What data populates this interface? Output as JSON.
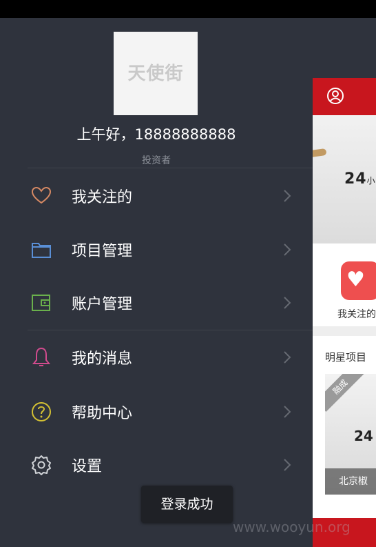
{
  "drawer": {
    "logo_text": "天使街",
    "greeting": "上午好，18888888888",
    "role": "投资者",
    "menu": [
      {
        "label": "我关注的",
        "icon": "heart-icon"
      },
      {
        "label": "项目管理",
        "icon": "folder-icon"
      },
      {
        "label": "账户管理",
        "icon": "wallet-icon"
      },
      {
        "label": "我的消息",
        "icon": "bell-icon"
      },
      {
        "label": "帮助中心",
        "icon": "help-icon"
      },
      {
        "label": "设置",
        "icon": "gear-icon"
      }
    ]
  },
  "main": {
    "banner_number": "24",
    "banner_unit": "小",
    "quick_label": "我关注的",
    "star_title": "明星项目",
    "star_card": {
      "ribbon": "融成",
      "number": "24",
      "caption": "北京椒"
    }
  },
  "toast": {
    "text": "登录成功"
  },
  "watermark": {
    "text": "www.wooyun.org"
  },
  "colors": {
    "drawer_bg": "#2f333d",
    "accent_red": "#c8161e",
    "heart": "#d88a64",
    "folder": "#5a8fd6",
    "wallet": "#6ab04c",
    "bell": "#d24b8e",
    "help": "#d4c133",
    "gear": "#cfd2d6"
  }
}
